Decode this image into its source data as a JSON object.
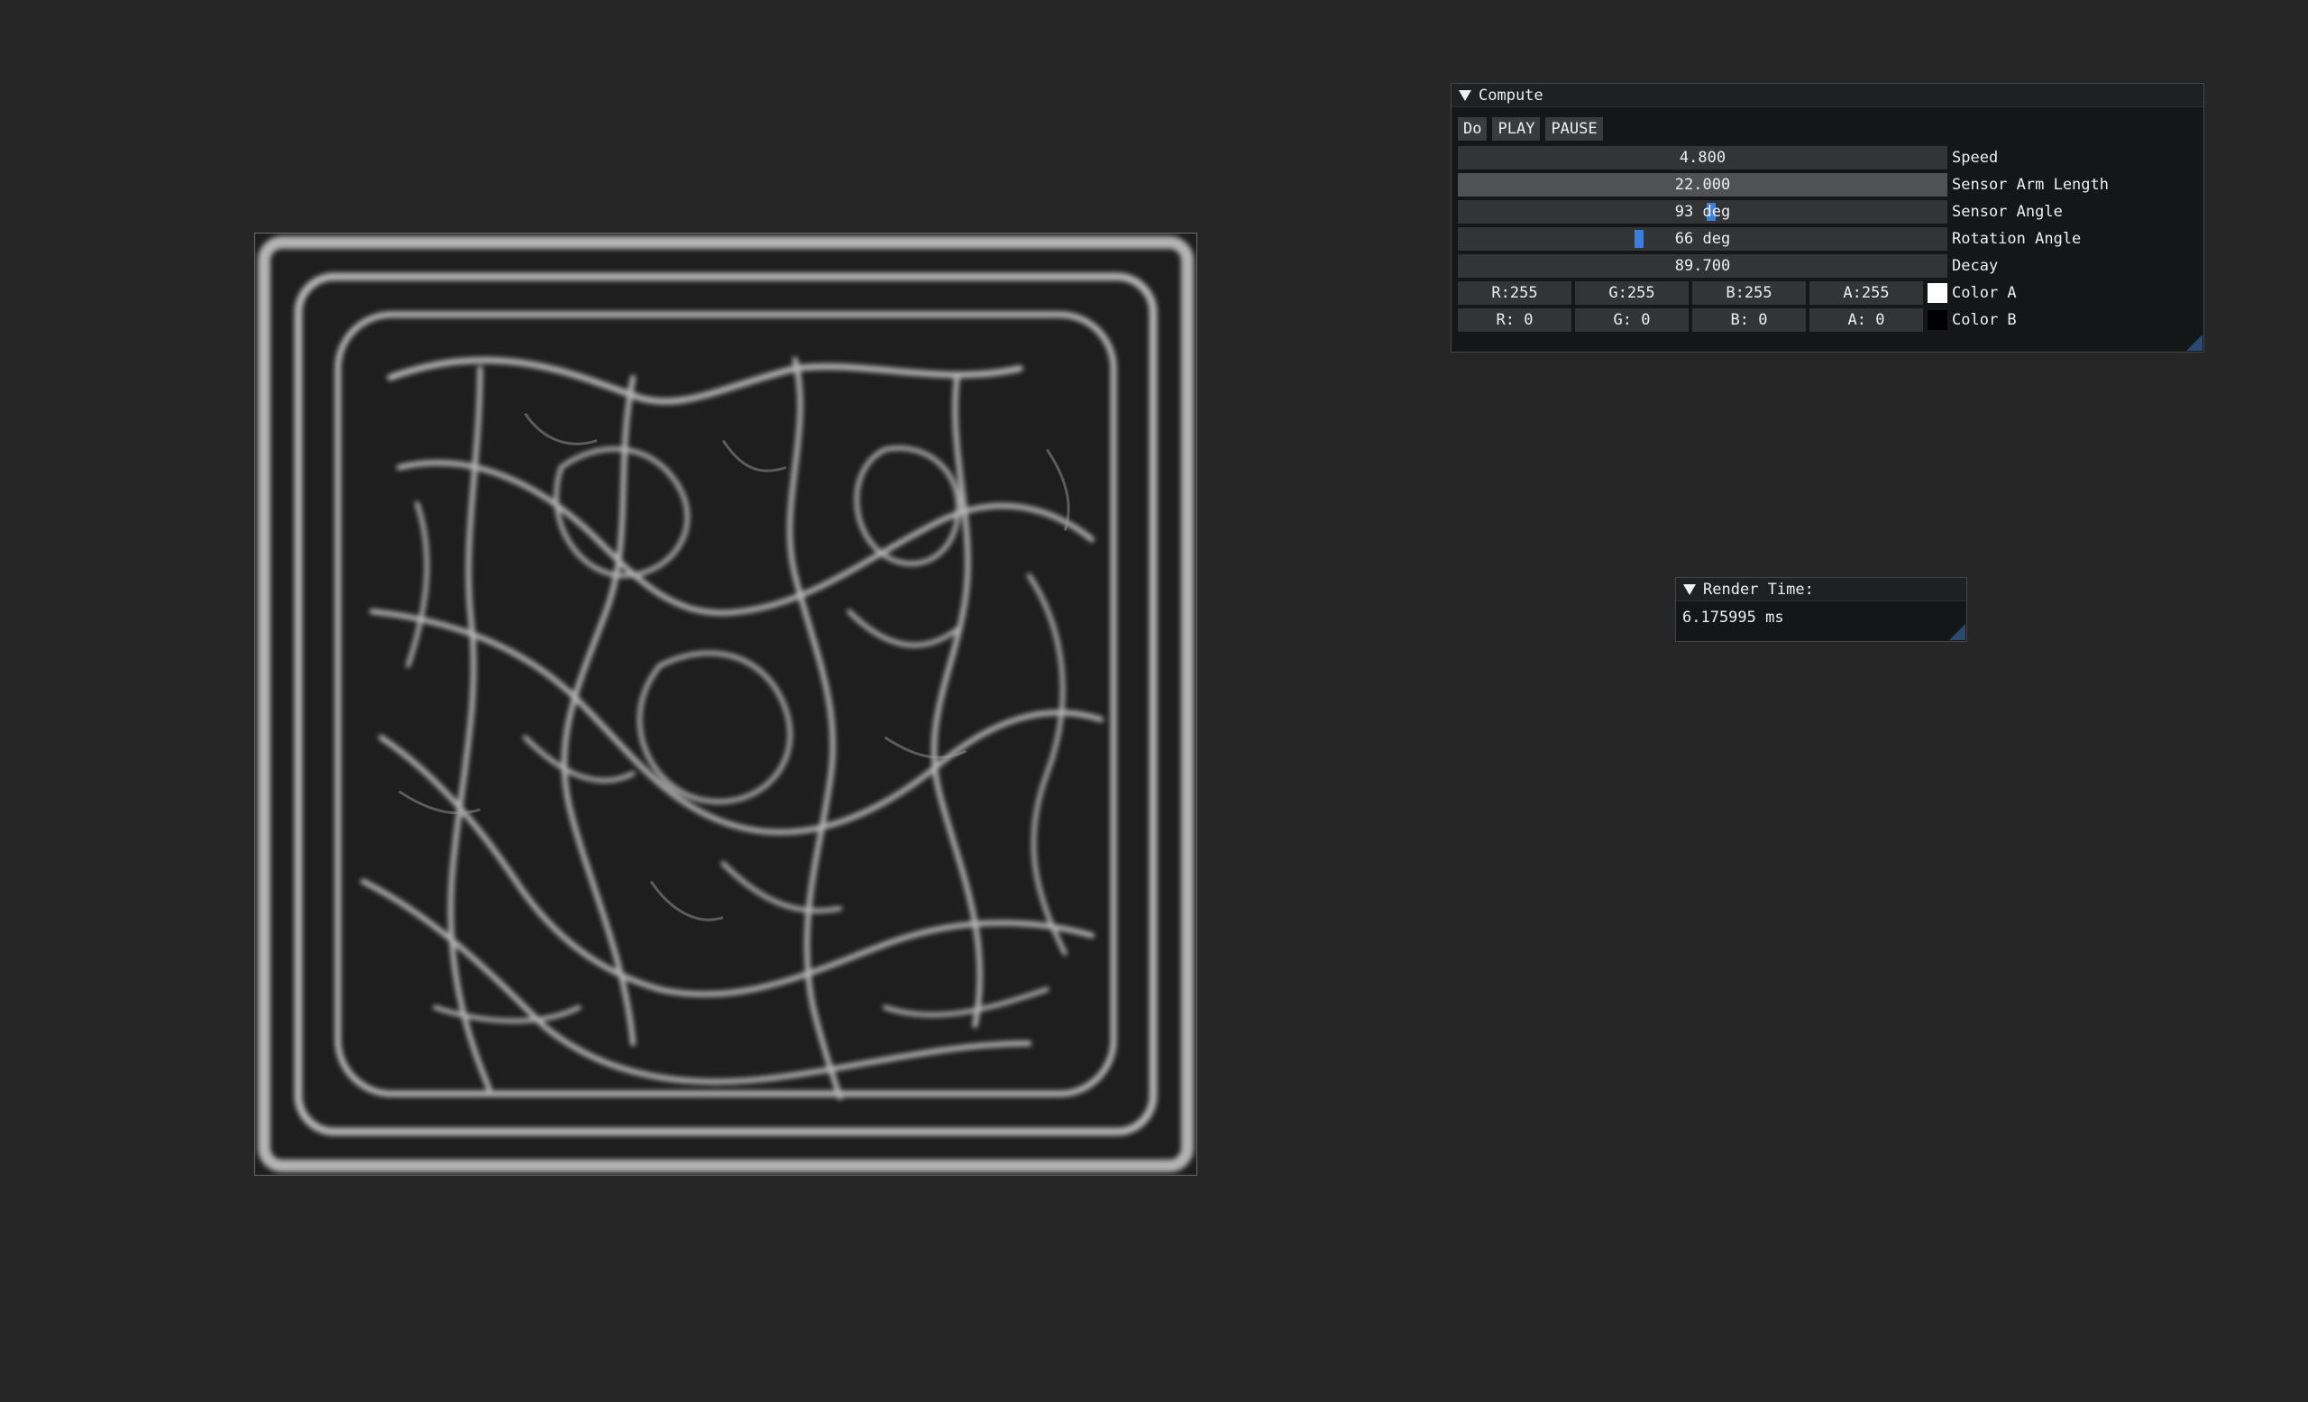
{
  "compute": {
    "title": "Compute",
    "buttons": [
      "Do",
      "PLAY",
      "PAUSE"
    ],
    "sliders": [
      {
        "value": "4.800",
        "label": "Speed",
        "active": false,
        "grab": null
      },
      {
        "value": "22.000",
        "label": "Sensor Arm Length",
        "active": true,
        "grab": null
      },
      {
        "value": "93 deg",
        "label": "Sensor Angle",
        "active": false,
        "grab": 0.517
      },
      {
        "value": "66 deg",
        "label": "Rotation Angle",
        "active": false,
        "grab": 0.367
      },
      {
        "value": "89.700",
        "label": "Decay",
        "active": false,
        "grab": null
      }
    ],
    "color_a": {
      "fields": [
        "R:255",
        "G:255",
        "B:255",
        "A:255"
      ],
      "swatch": "#ffffff",
      "label": "Color A"
    },
    "color_b": {
      "fields": [
        "R:  0",
        "G:  0",
        "B:  0",
        "A:  0"
      ],
      "swatch": "#000000",
      "label": "Color B"
    }
  },
  "render_time": {
    "title": "Render Time:",
    "value": "6.175995 ms"
  },
  "colors": {
    "background": "#262626",
    "accent": "#3c7ee0",
    "trail": "#d9d9d9"
  }
}
